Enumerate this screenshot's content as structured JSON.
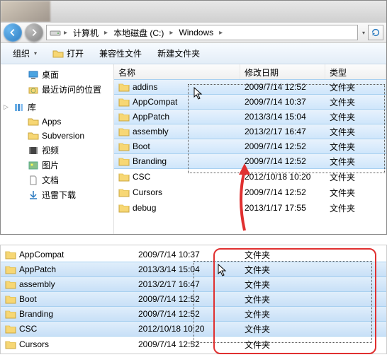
{
  "breadcrumb": {
    "root": "计算机",
    "parts": [
      "本地磁盘 (C:)",
      "Windows"
    ]
  },
  "toolbar": {
    "organize": "组织",
    "open": "打开",
    "compat": "兼容性文件",
    "newfolder": "新建文件夹"
  },
  "sidebar": {
    "desktop": "桌面",
    "recent": "最近访问的位置",
    "lib": "库",
    "apps": "Apps",
    "svn": "Subversion",
    "video": "视频",
    "pic": "图片",
    "doc": "文档",
    "xunlei": "迅雷下载"
  },
  "columns": {
    "name": "名称",
    "date": "修改日期",
    "type": "类型"
  },
  "type_folder": "文件夹",
  "rows1": [
    {
      "n": "addins",
      "d": "2009/7/14 12:52",
      "sel": true
    },
    {
      "n": "AppCompat",
      "d": "2009/7/14 10:37",
      "sel": true
    },
    {
      "n": "AppPatch",
      "d": "2013/3/14 15:04",
      "sel": true
    },
    {
      "n": "assembly",
      "d": "2013/2/17 16:47",
      "sel": true
    },
    {
      "n": "Boot",
      "d": "2009/7/14 12:52",
      "sel": true
    },
    {
      "n": "Branding",
      "d": "2009/7/14 12:52",
      "sel": true
    },
    {
      "n": "CSC",
      "d": "2012/10/18 10:20",
      "sel": false
    },
    {
      "n": "Cursors",
      "d": "2009/7/14 12:52",
      "sel": false
    },
    {
      "n": "debug",
      "d": "2013/1/17 17:55",
      "sel": false
    }
  ],
  "rows2": [
    {
      "n": "AppCompat",
      "d": "2009/7/14 10:37",
      "sel": false
    },
    {
      "n": "AppPatch",
      "d": "2013/3/14 15:04",
      "sel": true
    },
    {
      "n": "assembly",
      "d": "2013/2/17 16:47",
      "sel": true
    },
    {
      "n": "Boot",
      "d": "2009/7/14 12:52",
      "sel": true
    },
    {
      "n": "Branding",
      "d": "2009/7/14 12:52",
      "sel": true
    },
    {
      "n": "CSC",
      "d": "2012/10/18 10:20",
      "sel": true
    },
    {
      "n": "Cursors",
      "d": "2009/7/14 12:52",
      "sel": false
    }
  ]
}
